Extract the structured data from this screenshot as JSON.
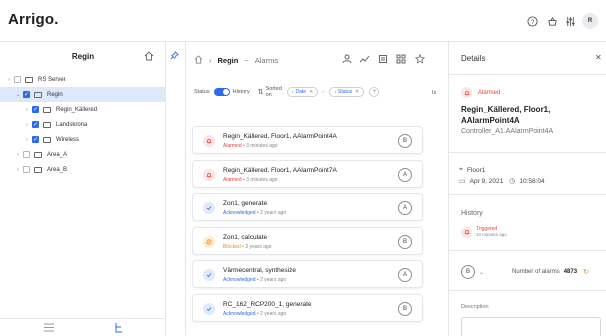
{
  "app": {
    "logo": "Arrigo."
  },
  "topbar": {
    "avatar_initial": "R"
  },
  "left_panel": {
    "title": "Regin",
    "tree": [
      {
        "label": "RS Server",
        "checked": false,
        "level": 0
      },
      {
        "label": "Regin",
        "checked": true,
        "level": 1,
        "selected": true
      },
      {
        "label": "Regin_Källered",
        "checked": true,
        "level": 2
      },
      {
        "label": "Landskrona",
        "checked": true,
        "level": 2
      },
      {
        "label": "Wireless",
        "checked": true,
        "level": 2
      },
      {
        "label": "Area_A",
        "checked": false,
        "level": 1
      },
      {
        "label": "Area_B",
        "checked": false,
        "level": 1
      }
    ]
  },
  "middle": {
    "breadcrumb": {
      "root": "Regin",
      "separator": "~",
      "page": "Alarms"
    },
    "filters": {
      "status_label": "Status",
      "history_label": "History",
      "sorted_on_label": "Sorted on",
      "chip_date": "Date",
      "chip_status": "Status",
      "count_label": "Is"
    },
    "alarms": [
      {
        "title": "Regin_Källered, Floor1, AAlarmPoint4A",
        "status": "Alarmed",
        "status_type": "alarmed",
        "time": "3 minutes ago",
        "priority": "B"
      },
      {
        "title": "Regin_Källered, Floor1, AAlarmPoint7A",
        "status": "Alarmed",
        "status_type": "alarmed",
        "time": "3 minutes ago",
        "priority": "A"
      },
      {
        "title": "Zon1, generate",
        "status": "Acknowledged",
        "status_type": "ack",
        "time": "2 years ago",
        "priority": "A"
      },
      {
        "title": "Zon1, calculate",
        "status": "Blocked",
        "status_type": "blocked",
        "time": "2 years ago",
        "priority": "B"
      },
      {
        "title": "Värmecentral, synthesize",
        "status": "Acknowledged",
        "status_type": "ack",
        "time": "2 years ago",
        "priority": "A"
      },
      {
        "title": "RC_162_RCP200_1, generate",
        "status": "Acknowledged",
        "status_type": "ack",
        "time": "2 years ago",
        "priority": "B"
      }
    ]
  },
  "details": {
    "title": "Details",
    "status": "Alarmed",
    "alarm_name": "Regin_Källered, Floor1, AAlarmPoint4A",
    "alarm_path": "Controller_A1.AAlarmPoint4A",
    "floor": "Floor1",
    "date": "Apr 9, 2021",
    "time": "10:58:04",
    "history_title": "History",
    "history_event": "Triggered",
    "history_time": "10 minutes ago",
    "priority": "B",
    "count_label": "Number of alarms",
    "count_value": "4873",
    "description_title": "Description"
  },
  "colors": {
    "accent": "#2e6be6",
    "alarmed": "#e2453c",
    "blocked": "#e88a1a",
    "selected_row": "#dde8fb"
  }
}
